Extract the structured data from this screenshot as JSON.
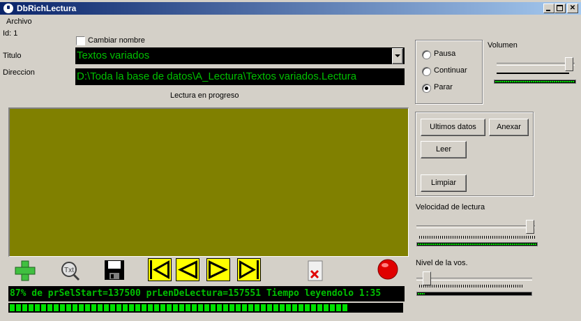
{
  "window": {
    "title": "DbRichLectura"
  },
  "menu": {
    "archivo": "Archivo"
  },
  "record": {
    "id_label": "Id: 1",
    "cambiar_nombre": "Cambiar nombre",
    "titulo_label": "Titulo",
    "titulo_value": "Textos variados",
    "direccion_label": "Direccion",
    "direccion_value": "D:\\Toda la base de datos\\A_Lectura\\Textos variados.Lectura"
  },
  "reading": {
    "status_label": "Lectura en progreso",
    "status_line": "87% de prSelStart=137500 prLenDeLectura=157551 Tiempo leyendolo 1:35",
    "progress": 0.87
  },
  "playback": {
    "pausa": "Pausa",
    "continuar": "Continuar",
    "parar": "Parar",
    "selected": "Parar"
  },
  "volume": {
    "label": "Volumen",
    "value": 1.0
  },
  "actions": {
    "ultimos_datos": "Ultimos datos",
    "anexar": "Anexar",
    "leer": "Leer",
    "limpiar": "Limpiar"
  },
  "speed": {
    "label": "Velocidad de lectura",
    "value": 0.97
  },
  "voice_level": {
    "label": "Nivel de la vos.",
    "value": 0.1
  },
  "colors": {
    "text_area": "#808000",
    "field_bg": "#000000",
    "field_text": "#00c000",
    "nav_yellow": "#ffff00",
    "accent_green": "#00e000"
  },
  "toolbar": {
    "icons": [
      "add-icon",
      "text-zoom-icon",
      "save-icon",
      "skip-start-icon",
      "rewind-icon",
      "forward-icon",
      "skip-end-icon",
      "delete-document-icon",
      "record-icon"
    ]
  }
}
